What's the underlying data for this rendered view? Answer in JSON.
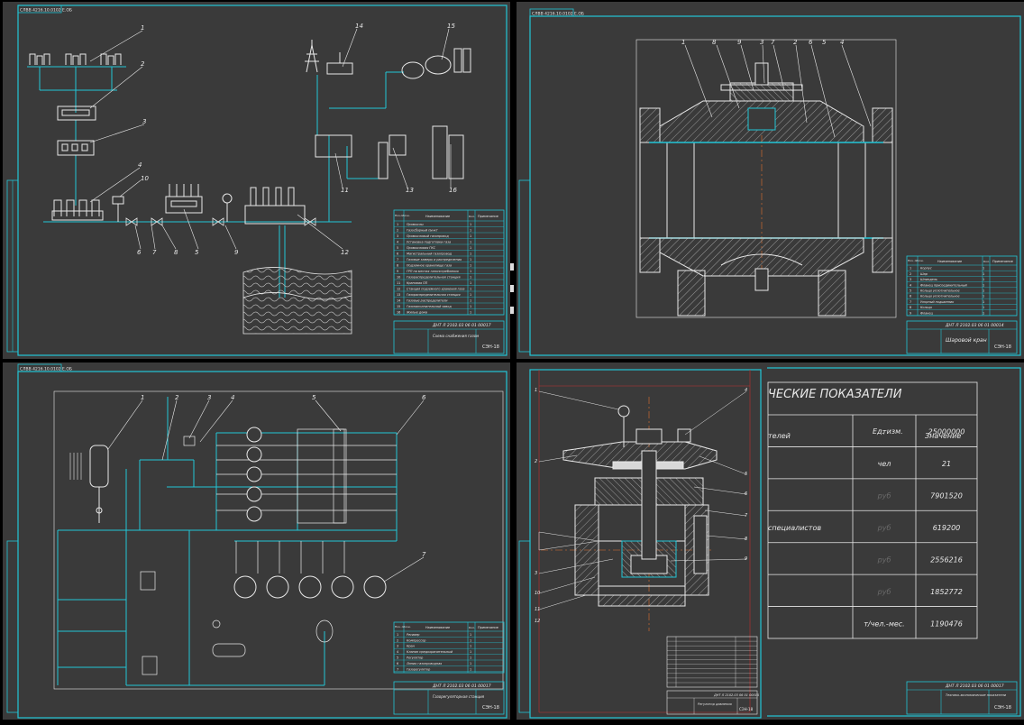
{
  "colors": {
    "background": "#3a3a3a",
    "frame": "#22c5d6",
    "linework": "#e8e8e8",
    "hatch": "#b8b8b8",
    "center": "#e07030",
    "red_line": "#c03030"
  },
  "sheet1": {
    "code": "СЛВВ 4216.10.0102 Е.ОБ",
    "callouts": [
      "1",
      "2",
      "3",
      "4",
      "5",
      "6",
      "7",
      "8",
      "9",
      "10",
      "11",
      "12",
      "13",
      "14",
      "15",
      "16"
    ],
    "spec_header": [
      "Поз.обозн.",
      "Наименование",
      "Кол.",
      "Примечание"
    ],
    "spec_rows": [
      "Промыслы",
      "Газосборный пункт",
      "Промысловый газопровод",
      "Установка подготовки газа",
      "Промысловая ГКС",
      "Магистральный газопровод",
      "Газовые замеры и распределения",
      "Подземное хранилище газа",
      "ГРП на местах газопотребления",
      "Газораспределительная станция",
      "Крановая ПП",
      "Станция подземного хранения газа",
      "Газораспределительная станция",
      "Газовые распределители",
      "Газонаполнительный завод",
      "Жилые дома"
    ],
    "stamp_code": "ДНТ Л 2102.03 06 01 00017",
    "stamp_title": "Схема снабжения газом",
    "stamp_group": "СЭН-18"
  },
  "sheet2": {
    "code": "СЛВВ 4216.10.0102 Е.ОБ",
    "callouts": [
      "1",
      "8",
      "9",
      "3",
      "7",
      "2",
      "6",
      "5",
      "4"
    ],
    "spec_header": [
      "Поз. обозн.",
      "Наименование",
      "Кол.",
      "Примечание"
    ],
    "spec_rows": [
      "Корпус",
      "Шар",
      "Шпиндель",
      "Фланец присоединительный",
      "Кольцо уплотнительное",
      "Кольцо уплотнительное",
      "Упорный подшипник",
      "Кольцо",
      "Фланец"
    ],
    "stamp_code": "ДНТ Л 2102.03 06 01 00014",
    "stamp_title": "Шаровой кран",
    "stamp_group": "СЭН-18"
  },
  "sheet3": {
    "code": "СЛВВ 4216.10.0102 Е.ОБ",
    "callouts": [
      "1",
      "2",
      "3",
      "4",
      "5",
      "6",
      "7"
    ],
    "spec_header": [
      "Поз. обозн.",
      "Наименование",
      "Кол.",
      "Примечание"
    ],
    "spec_rows": [
      "Ресивер",
      "Компрессор",
      "Кран",
      "Клапан предохранительный",
      "Регулятор",
      "Линия газопроводная",
      "Газорегулятор"
    ],
    "stamp_code": "ДНТ Л 2102.03 06 01 00017",
    "stamp_title": "Газорегуляторная станция",
    "stamp_group": "СЭН-18"
  },
  "sheet4": {
    "title": "ЧЕСКИЕ ПОКАЗАТЕЛИ",
    "col_name": "телей",
    "col_unit": "Ед. изм.",
    "col_value": "Значение",
    "rows": [
      {
        "name": "",
        "unit": "т",
        "value": "25000000"
      },
      {
        "name": "",
        "unit": "чел",
        "value": "21"
      },
      {
        "name": "",
        "unit": "руб",
        "value": "7901520"
      },
      {
        "name": "специалистов",
        "unit": "руб",
        "value": "619200"
      },
      {
        "name": "",
        "unit": "руб",
        "value": "2556216"
      },
      {
        "name": "",
        "unit": "руб",
        "value": "1852772"
      },
      {
        "name": "",
        "unit": "т/чел.-мес.",
        "value": "1190476"
      }
    ],
    "stamp_code": "ДНТ Л 2102.03 06 01 00017",
    "stamp_title": "Технико-экономические показатели",
    "stamp_group": "СЭН-18"
  },
  "sheet5": {
    "callouts_left": [
      "1",
      "2",
      "3",
      "10",
      "11",
      "12"
    ],
    "callouts_right": [
      "4",
      "5",
      "6",
      "7",
      "8",
      "9"
    ],
    "stamp_code": "ДНТ Л 2102.03 06 01 00015",
    "stamp_title": "Регулятор давления",
    "stamp_group": "СЭН-18"
  }
}
